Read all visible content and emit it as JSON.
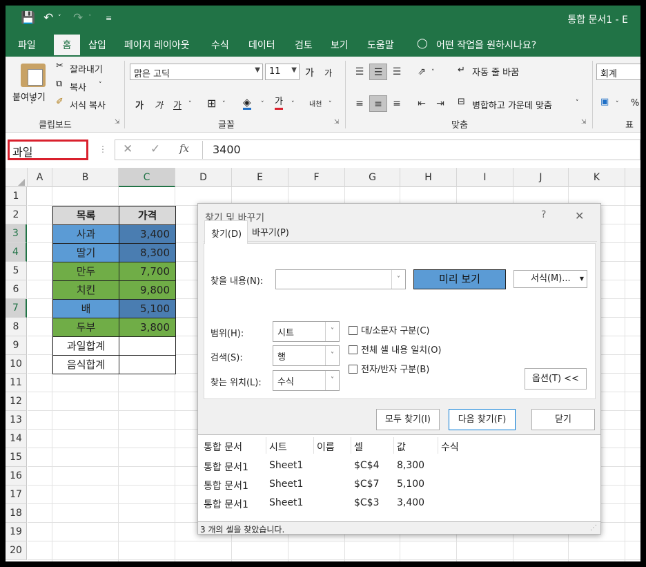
{
  "title_bar": {
    "doc_title": "통합 문서1 - E"
  },
  "menu": {
    "items": [
      "파일",
      "홈",
      "삽입",
      "페이지 레이아웃",
      "수식",
      "데이터",
      "검토",
      "보기",
      "도움말"
    ],
    "tell_me": "어떤 작업을 원하시나요?"
  },
  "ribbon": {
    "clipboard": {
      "paste": "붙여넣기",
      "cut": "잘라내기",
      "copy": "복사",
      "format_painter": "서식 복사",
      "group": "클립보드"
    },
    "font": {
      "name": "맑은 고딕",
      "size": "11",
      "grow": "가",
      "shrink": "가",
      "bold": "가",
      "italic": "가",
      "underline": "가",
      "font_color": "가",
      "phonetic": "내천",
      "group": "글꼴"
    },
    "alignment": {
      "wrap": "자동 줄 바꿈",
      "merge": "병합하고 가운데 맞춤",
      "group": "맞춤"
    },
    "number": {
      "format": "회계",
      "percent": "%",
      "group": "표시"
    }
  },
  "formula_bar": {
    "name_box": "과일",
    "value": "3400",
    "fx": "fx"
  },
  "sheet": {
    "columns": [
      "A",
      "B",
      "C",
      "D",
      "E",
      "F",
      "G",
      "H",
      "I",
      "J",
      "K"
    ],
    "rows": [
      "1",
      "2",
      "3",
      "4",
      "5",
      "6",
      "7",
      "8",
      "9",
      "10",
      "11",
      "12",
      "13",
      "14",
      "15",
      "16",
      "17",
      "18",
      "19",
      "20"
    ],
    "header": [
      "목록",
      "가격"
    ],
    "items": [
      {
        "name": "사과",
        "price": "3,400",
        "cat": "fruit",
        "sel": true
      },
      {
        "name": "딸기",
        "price": "8,300",
        "cat": "fruit",
        "sel": true
      },
      {
        "name": "만두",
        "price": "7,700",
        "cat": "food",
        "sel": false
      },
      {
        "name": "치킨",
        "price": "9,800",
        "cat": "food",
        "sel": false
      },
      {
        "name": "배",
        "price": "5,100",
        "cat": "fruit",
        "sel": true
      },
      {
        "name": "두부",
        "price": "3,800",
        "cat": "food",
        "sel": false
      }
    ],
    "totals": [
      "과일합계",
      "음식합계"
    ],
    "colors": {
      "fruit": "#5b9bd5",
      "food": "#70ad47",
      "fruit_selected": "#4a7db1",
      "header_bg": "#d9d9d9"
    }
  },
  "dialog": {
    "title": "찾기 및 바꾸기",
    "help": "?",
    "close": "✕",
    "tabs": [
      "찾기(D)",
      "바꾸기(P)"
    ],
    "find_label": "찾을 내용(N):",
    "find_value": "",
    "preview": "미리 보기",
    "format_btn": "서식(M)...",
    "scope_label": "범위(H):",
    "scope_value": "시트",
    "search_label": "검색(S):",
    "search_value": "행",
    "lookin_label": "찾는 위치(L):",
    "lookin_value": "수식",
    "checks": [
      "대/소문자 구분(C)",
      "전체 셀 내용 일치(O)",
      "전자/반자 구분(B)"
    ],
    "options": "옵션(T) <<",
    "find_all": "모두 찾기(I)",
    "find_next": "다음 찾기(F)",
    "close_btn": "닫기",
    "results_header": [
      "통합 문서",
      "시트",
      "이름",
      "셀",
      "값",
      "수식"
    ],
    "results": [
      [
        "통합 문서1",
        "Sheet1",
        "",
        "$C$4",
        "8,300",
        ""
      ],
      [
        "통합 문서1",
        "Sheet1",
        "",
        "$C$7",
        "5,100",
        ""
      ],
      [
        "통합 문서1",
        "Sheet1",
        "",
        "$C$3",
        "3,400",
        ""
      ]
    ],
    "status": "3 개의 셀을 찾았습니다."
  }
}
